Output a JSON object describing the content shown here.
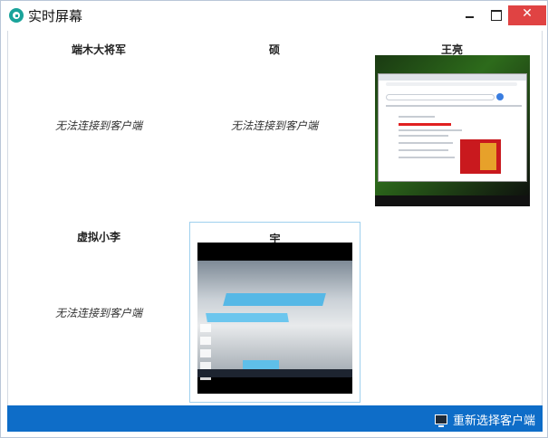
{
  "window": {
    "title": "实时屏幕",
    "close_glyph": "✕"
  },
  "clients": [
    {
      "name": "端木大将军",
      "status": "无法连接到客户端"
    },
    {
      "name": "硕",
      "status": "无法连接到客户端"
    },
    {
      "name": "王亮",
      "status": "",
      "screen": "browser-screenshot"
    },
    {
      "name": "虚拟小李",
      "status": "无法连接到客户端"
    },
    {
      "name": "宇",
      "status": "",
      "screen": "desktop-screenshot",
      "selected": true
    }
  ],
  "footer": {
    "reselect_label": "重新选择客户端"
  },
  "colors": {
    "accent": "#0e6dc8",
    "close": "#e04343",
    "app_icon": "#1aa39a",
    "selection_border": "#9fd0ee"
  }
}
